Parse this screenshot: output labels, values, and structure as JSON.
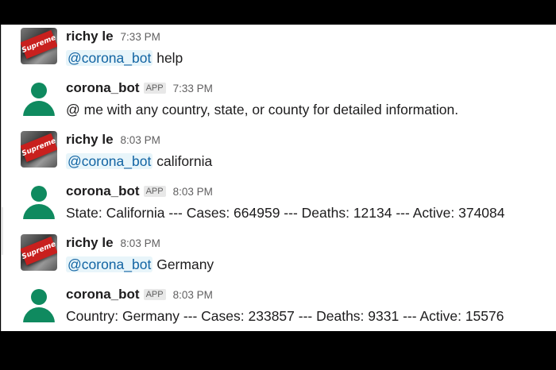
{
  "messages": [
    {
      "author": "richy le",
      "is_bot": false,
      "time": "7:33 PM",
      "mention": "@corona_bot",
      "text": " help",
      "avatar_logo": "Supreme"
    },
    {
      "author": "corona_bot",
      "is_bot": true,
      "badge": "APP",
      "time": "7:33 PM",
      "text": "@ me with any country, state, or county for detailed information."
    },
    {
      "author": "richy le",
      "is_bot": false,
      "time": "8:03 PM",
      "mention": "@corona_bot",
      "text": " california",
      "avatar_logo": "Supreme"
    },
    {
      "author": "corona_bot",
      "is_bot": true,
      "badge": "APP",
      "time": "8:03 PM",
      "text": "State: California --- Cases: 664959 --- Deaths: 12134 --- Active: 374084"
    },
    {
      "author": "richy le",
      "is_bot": false,
      "time": "8:03 PM",
      "mention": "@corona_bot",
      "text": " Germany",
      "avatar_logo": "Supreme"
    },
    {
      "author": "corona_bot",
      "is_bot": true,
      "badge": "APP",
      "time": "8:03 PM",
      "text": "Country: Germany --- Cases: 233857 --- Deaths: 9331 --- Active: 15576"
    }
  ],
  "colors": {
    "bot_avatar": "#0f8a5f",
    "mention_text": "#1264a3",
    "mention_bg": "#e8f5fa",
    "user_logo_red": "#c8201e"
  }
}
